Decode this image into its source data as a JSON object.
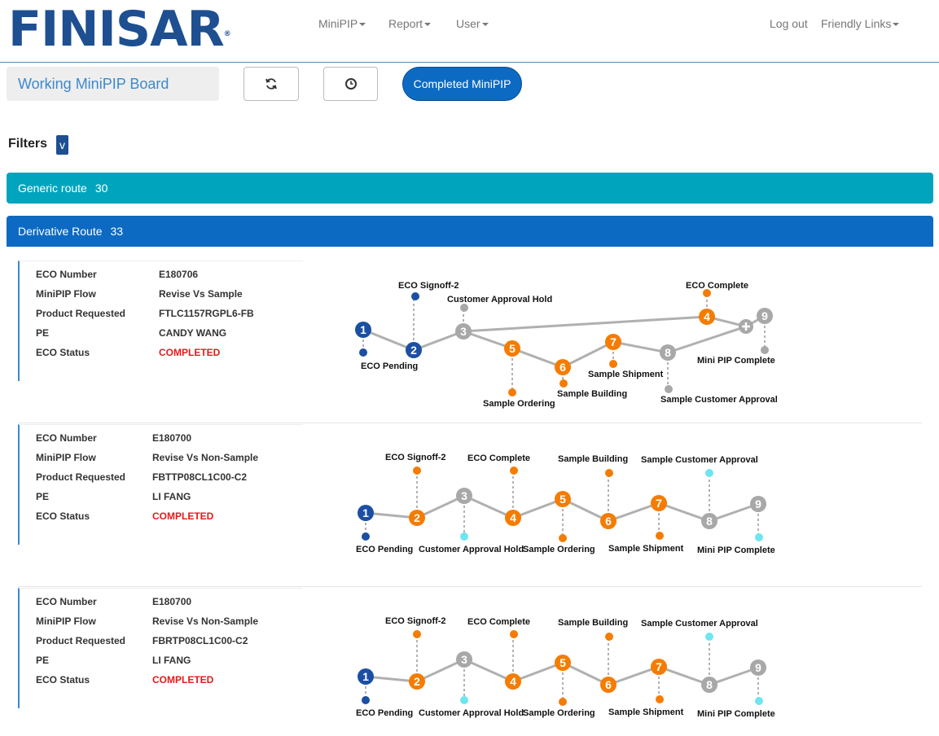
{
  "brand": {
    "logo": "FINISAR",
    "registered": "®"
  },
  "nav": {
    "minipip": "MiniPIP",
    "report": "Report",
    "user": "User",
    "logout": "Log out",
    "friendly_links": "Friendly Links"
  },
  "toolbar": {
    "board_title": "Working MiniPIP Board",
    "refresh_icon": "refresh-icon",
    "history_icon": "clock-icon",
    "completed_button": "Completed MiniPIP"
  },
  "filters": {
    "label": "Filters",
    "toggle": "v"
  },
  "routes": {
    "generic": {
      "label": "Generic route",
      "count": "30"
    },
    "derivative": {
      "label": "Derivative Route",
      "count": "33"
    }
  },
  "field_labels": {
    "eco_number": "ECO Number",
    "minipip_flow": "MiniPIP Flow",
    "product_requested": "Product Requested",
    "pe": "PE",
    "eco_status": "ECO Status"
  },
  "cards": [
    {
      "eco_number": "E180706",
      "minipip_flow": "Revise Vs Sample",
      "product_requested": "FTLC1157RGPL6-FB",
      "pe": "CANDY WANG",
      "eco_status": "COMPLETED",
      "steps": [
        "ECO Pending",
        "ECO Signoff-2",
        "Customer Approval Hold",
        "ECO Complete",
        "Sample Ordering",
        "Sample Building",
        "Sample Shipment",
        "Sample Customer Approval",
        "Mini PIP Complete"
      ]
    },
    {
      "eco_number": "E180700",
      "minipip_flow": "Revise Vs Non-Sample",
      "product_requested": "FBTTP08CL1C00-C2",
      "pe": "LI FANG",
      "eco_status": "COMPLETED",
      "steps": [
        "ECO Pending",
        "ECO Signoff-2",
        "Customer Approval Hold",
        "ECO Complete",
        "Sample Ordering",
        "Sample Building",
        "Sample Shipment",
        "Sample Customer Approval",
        "Mini PIP Complete"
      ]
    },
    {
      "eco_number": "E180700",
      "minipip_flow": "Revise Vs Non-Sample",
      "product_requested": "FBRTP08CL1C00-C2",
      "pe": "LI FANG",
      "eco_status": "COMPLETED",
      "steps": [
        "ECO Pending",
        "ECO Signoff-2",
        "Customer Approval Hold",
        "ECO Complete",
        "Sample Ordering",
        "Sample Building",
        "Sample Shipment",
        "Sample Customer Approval",
        "Mini PIP Complete"
      ]
    }
  ],
  "colors": {
    "brand_blue": "#1d4f91",
    "step_blue": "#1b4fa3",
    "step_orange": "#f57c00",
    "step_gray": "#a8a8a8",
    "step_cyan": "#6ee6f0",
    "status_red": "#e11b1b"
  }
}
